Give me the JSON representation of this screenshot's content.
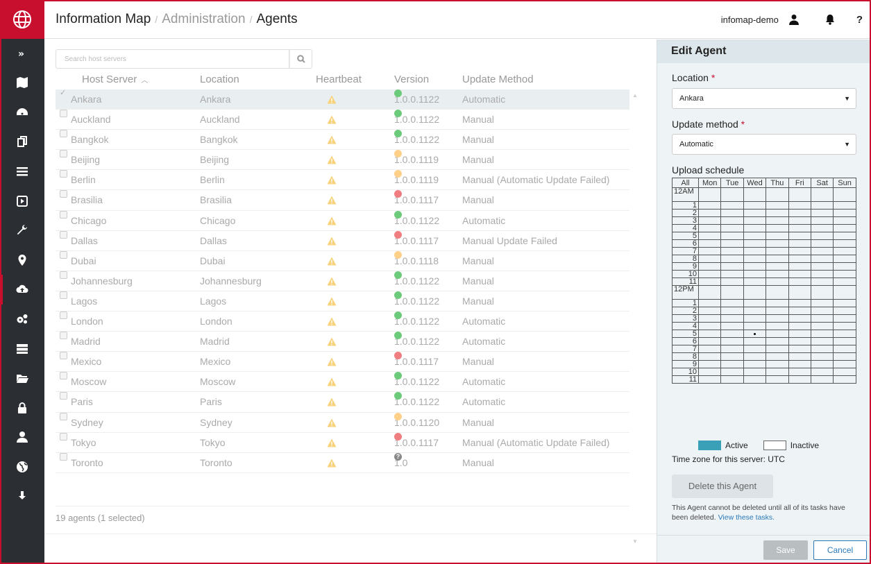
{
  "breadcrumb": {
    "app": "Information Map",
    "section": "Administration",
    "page": "Agents"
  },
  "header": {
    "username": "infomap-demo",
    "help": "?"
  },
  "sidebar": {
    "icons": [
      "expand-icon",
      "map-icon",
      "dashboard-icon",
      "copy-icon",
      "list-icon",
      "play-icon",
      "wrench-icon",
      "location-pin-icon",
      "cloud-upload-icon",
      "cogs-icon",
      "servers-icon",
      "folder-icon",
      "lock-icon",
      "user-icon",
      "globe-icon",
      "download-icon"
    ],
    "active_index": 8
  },
  "search": {
    "placeholder": "Search host servers"
  },
  "table": {
    "columns": [
      "Host Server",
      "Location",
      "Heartbeat",
      "Version",
      "Update Method"
    ],
    "rows": [
      {
        "host": "Ankara",
        "location": "Ankara",
        "version": "1.0.0.1122",
        "status": "green",
        "method": "Automatic",
        "selected": true
      },
      {
        "host": "Auckland",
        "location": "Auckland",
        "version": "1.0.0.1122",
        "status": "green",
        "method": "Manual"
      },
      {
        "host": "Bangkok",
        "location": "Bangkok",
        "version": "1.0.0.1122",
        "status": "green",
        "method": "Manual"
      },
      {
        "host": "Beijing",
        "location": "Beijing",
        "version": "1.0.0.1119",
        "status": "orange",
        "method": "Manual"
      },
      {
        "host": "Berlin",
        "location": "Berlin",
        "version": "1.0.0.1119",
        "status": "orange",
        "method": "Manual (Automatic Update Failed)"
      },
      {
        "host": "Brasilia",
        "location": "Brasilia",
        "version": "1.0.0.1117",
        "status": "red",
        "method": "Manual"
      },
      {
        "host": "Chicago",
        "location": "Chicago",
        "version": "1.0.0.1122",
        "status": "green",
        "method": "Automatic"
      },
      {
        "host": "Dallas",
        "location": "Dallas",
        "version": "1.0.0.1117",
        "status": "red",
        "method": "Manual Update Failed"
      },
      {
        "host": "Dubai",
        "location": "Dubai",
        "version": "1.0.0.1118",
        "status": "orange",
        "method": "Manual"
      },
      {
        "host": "Johannesburg",
        "location": "Johannesburg",
        "version": "1.0.0.1122",
        "status": "green",
        "method": "Manual"
      },
      {
        "host": "Lagos",
        "location": "Lagos",
        "version": "1.0.0.1122",
        "status": "green",
        "method": "Manual"
      },
      {
        "host": "London",
        "location": "London",
        "version": "1.0.0.1122",
        "status": "green",
        "method": "Automatic"
      },
      {
        "host": "Madrid",
        "location": "Madrid",
        "version": "1.0.0.1122",
        "status": "green",
        "method": "Automatic"
      },
      {
        "host": "Mexico",
        "location": "Mexico",
        "version": "1.0.0.1117",
        "status": "red",
        "method": "Manual"
      },
      {
        "host": "Moscow",
        "location": "Moscow",
        "version": "1.0.0.1122",
        "status": "green",
        "method": "Automatic"
      },
      {
        "host": "Paris",
        "location": "Paris",
        "version": "1.0.0.1122",
        "status": "green",
        "method": "Automatic"
      },
      {
        "host": "Sydney",
        "location": "Sydney",
        "version": "1.0.0.1120",
        "status": "orange",
        "method": "Manual"
      },
      {
        "host": "Tokyo",
        "location": "Tokyo",
        "version": "1.0.0.1117",
        "status": "red",
        "method": "Manual (Automatic Update Failed)"
      },
      {
        "host": "Toronto",
        "location": "Toronto",
        "version": "1.0",
        "status": "unknown",
        "method": "Manual"
      }
    ],
    "footer": "19 agents (1 selected)"
  },
  "status_colors": {
    "green": "#6ccb7a",
    "orange": "#ffd08a",
    "red": "#f07d80",
    "warning": "#f8d27a",
    "accent": "#c8102e",
    "active": "#3aa0b8"
  },
  "panel": {
    "title": "Edit Agent",
    "location_label": "Location",
    "location_value": "Ankara",
    "update_label": "Update method",
    "update_value": "Automatic",
    "required_mark": "*",
    "schedule_label": "Upload schedule",
    "schedule_all": "All",
    "days": [
      "Mon",
      "Tue",
      "Wed",
      "Thu",
      "Fri",
      "Sat",
      "Sun"
    ],
    "hours": [
      "12AM",
      "1",
      "2",
      "3",
      "4",
      "5",
      "6",
      "7",
      "8",
      "9",
      "10",
      "11",
      "12PM",
      "1",
      "2",
      "3",
      "4",
      "5",
      "6",
      "7",
      "8",
      "9",
      "10",
      "11"
    ],
    "legend_active": "Active",
    "legend_inactive": "Inactive",
    "timezone": "Time zone for this server: UTC",
    "delete_label": "Delete this Agent",
    "note_text": "This Agent cannot be deleted until all of its tasks have been deleted.",
    "note_link": "View these tasks.",
    "save_label": "Save",
    "cancel_label": "Cancel"
  }
}
